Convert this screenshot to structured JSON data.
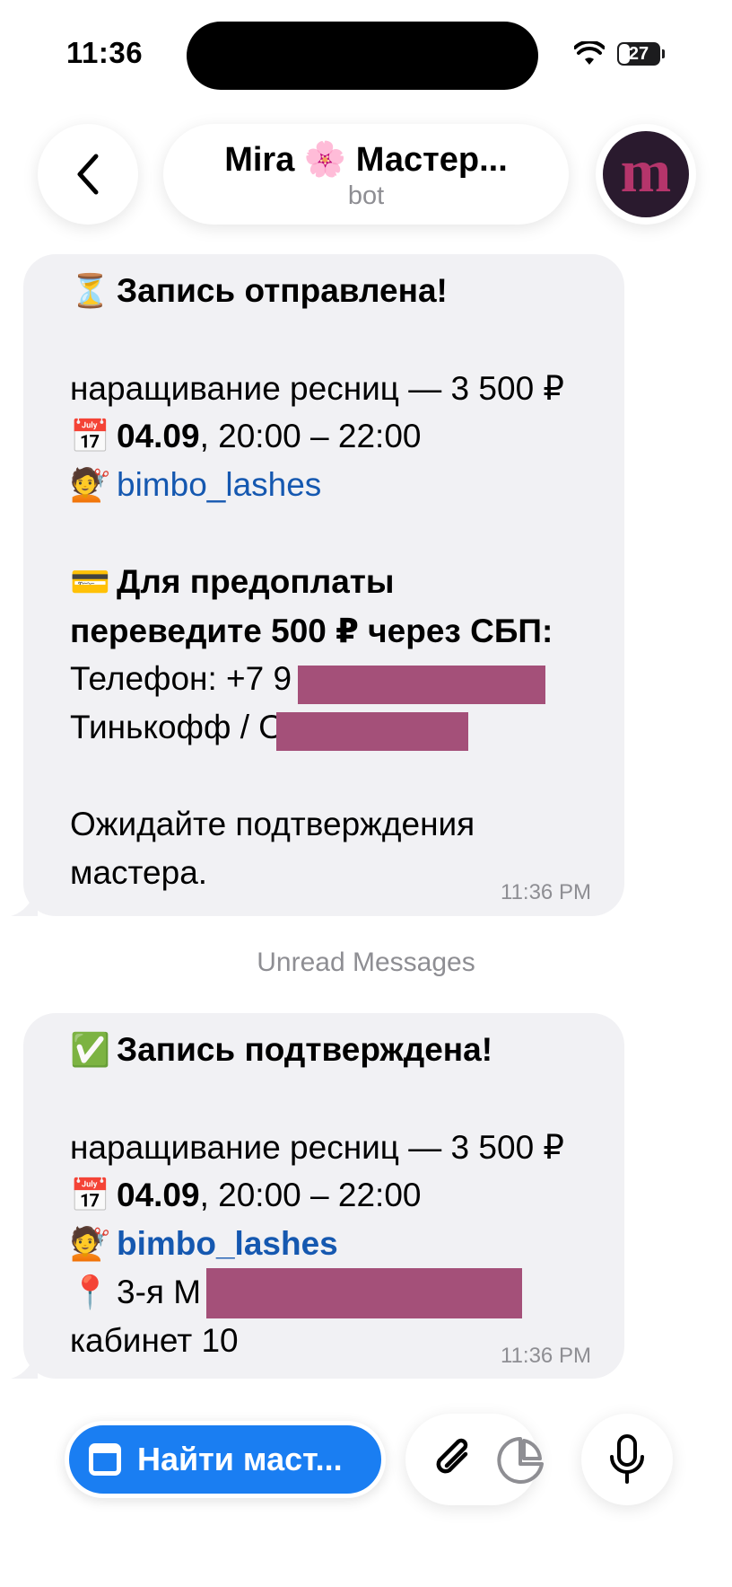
{
  "status_bar": {
    "time": "11:36",
    "battery": "27"
  },
  "header": {
    "title": "Mira 🌸 Мастер...",
    "subtitle": "bot",
    "avatar_letter": "m"
  },
  "messages": [
    {
      "heading_emoji": "⏳",
      "heading": "Запись отправлена!",
      "service": "наращивание ресниц — 3 500 ₽",
      "date_emoji": "📅",
      "date": "04.09",
      "time_range": ", 20:00 – 22:00",
      "master_emoji": "💇",
      "master": "bimbo_lashes",
      "payment_emoji": "💳",
      "payment_line1": "Для предоплаты",
      "payment_line2": "переведите 500 ₽ через СБП:",
      "phone": "Телефон: +7  9",
      "bank": "Тинькофф / О",
      "wait_line1": "Ожидайте подтверждения",
      "wait_line2": "мастера.",
      "timestamp": "11:36 PM"
    },
    {
      "heading_emoji": "✅",
      "heading": "Запись подтверждена!",
      "service": "наращивание ресниц — 3 500 ₽",
      "date_emoji": "📅",
      "date": "04.09",
      "time_range": ", 20:00 – 22:00",
      "master_emoji": "💇",
      "master": "bimbo_lashes",
      "address_emoji": "📍",
      "address": "3-я М",
      "cabinet": "кабинет 10",
      "timestamp": "11:36 PM"
    }
  ],
  "unread_divider": "Unread Messages",
  "bottom_bar": {
    "find_button": "Найти маст..."
  },
  "colors": {
    "accent": "#1a7ef2",
    "link": "#1558b0",
    "bubble": "#f1f1f4",
    "redaction": "#a45079"
  }
}
